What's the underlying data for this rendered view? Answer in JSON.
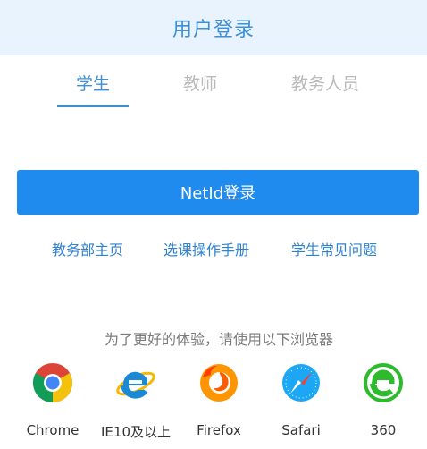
{
  "header": {
    "title": "用户登录"
  },
  "tabs": [
    {
      "label": "学生",
      "active": true
    },
    {
      "label": "教师",
      "active": false
    },
    {
      "label": "教务人员",
      "active": false
    }
  ],
  "login": {
    "button_label": "NetId登录"
  },
  "links": [
    {
      "label": "教务部主页"
    },
    {
      "label": "选课操作手册"
    },
    {
      "label": "学生常见问题"
    }
  ],
  "hint": {
    "text": "为了更好的体验，请使用以下浏览器"
  },
  "browsers": [
    {
      "name": "Chrome",
      "icon": "chrome-icon"
    },
    {
      "name": "IE10及以上",
      "icon": "ie-icon"
    },
    {
      "name": "Firefox",
      "icon": "firefox-icon"
    },
    {
      "name": "Safari",
      "icon": "safari-icon"
    },
    {
      "name": "360",
      "icon": "browser-360-icon"
    }
  ],
  "colors": {
    "accent": "#3d8fd6",
    "button": "#1f8bef",
    "header_bg": "#e8f3fd",
    "tab_inactive": "#b9b9b9"
  }
}
